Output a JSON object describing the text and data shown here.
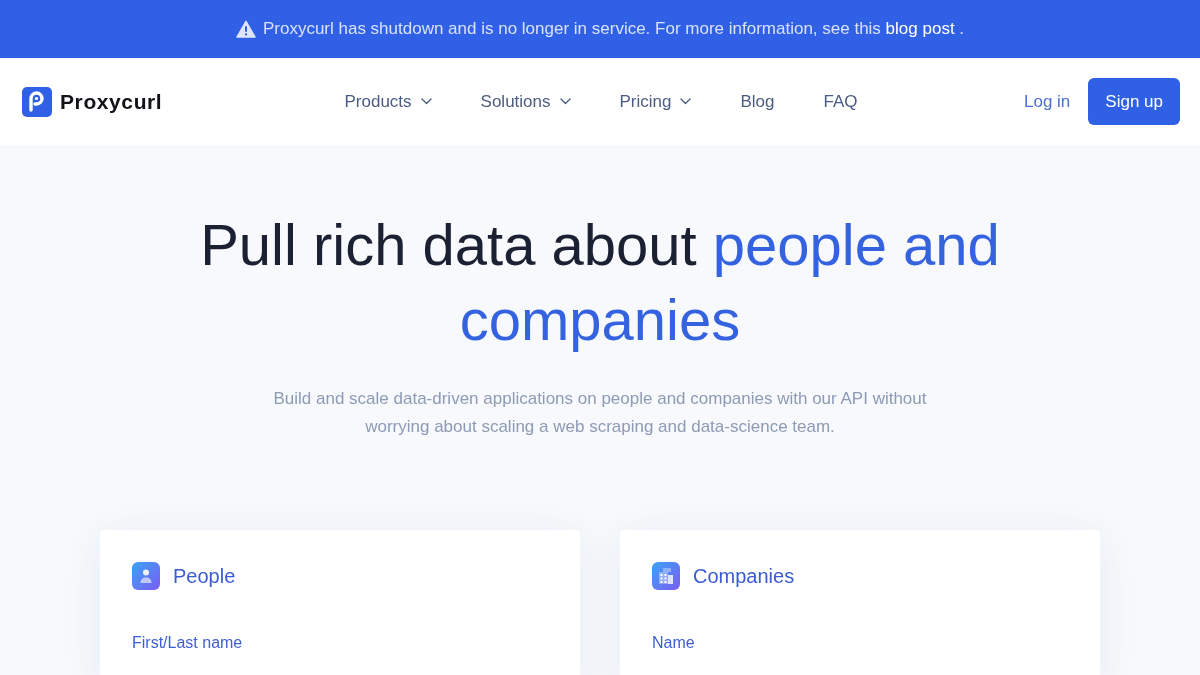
{
  "banner": {
    "text": "Proxycurl has shutdown and is no longer in service. For more information, see this",
    "link": "blog post",
    "trailing": "."
  },
  "header": {
    "brand": "Proxycurl",
    "nav": [
      {
        "label": "Products",
        "dropdown": true
      },
      {
        "label": "Solutions",
        "dropdown": true
      },
      {
        "label": "Pricing",
        "dropdown": true
      },
      {
        "label": "Blog",
        "dropdown": false
      },
      {
        "label": "FAQ",
        "dropdown": false
      }
    ],
    "login": "Log in",
    "signup": "Sign up"
  },
  "hero": {
    "headline": "Pull rich data about",
    "headline_highlight": "people and companies",
    "subtitle": "Build and scale data-driven applications on people and companies with our API without worrying about scaling a web scraping and data-science team."
  },
  "cards": [
    {
      "kind": "people",
      "title": "People",
      "field_label": "First/Last name"
    },
    {
      "kind": "companies",
      "title": "Companies",
      "field_label": "Name"
    }
  ]
}
